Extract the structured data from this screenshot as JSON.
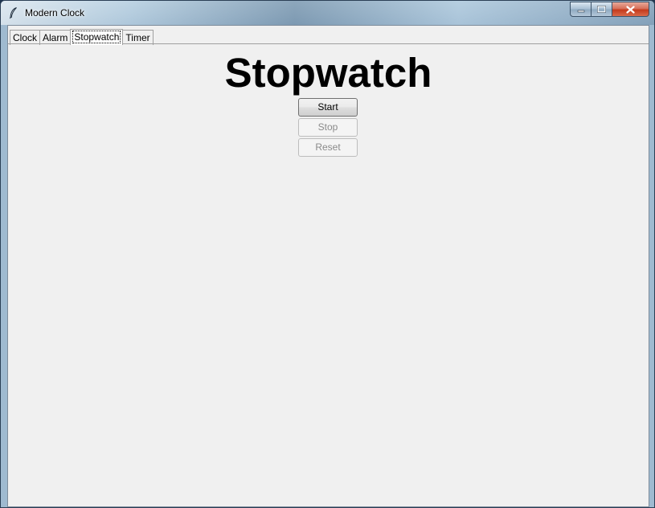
{
  "window": {
    "title": "Modern Clock",
    "icon": "feather-icon",
    "controls": {
      "minimize_icon": "minimize-icon",
      "maximize_icon": "maximize-icon",
      "close_icon": "close-icon"
    }
  },
  "tabs": [
    {
      "label": "Clock",
      "active": false
    },
    {
      "label": "Alarm",
      "active": false
    },
    {
      "label": "Stopwatch",
      "active": true
    },
    {
      "label": "Timer",
      "active": false
    }
  ],
  "stopwatch": {
    "heading": "Stopwatch",
    "buttons": {
      "start": {
        "label": "Start",
        "enabled": true
      },
      "stop": {
        "label": "Stop",
        "enabled": false
      },
      "reset": {
        "label": "Reset",
        "enabled": false
      }
    }
  }
}
